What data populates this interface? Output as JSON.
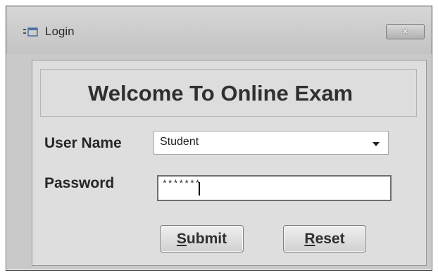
{
  "window": {
    "title": "Login",
    "close_label": "×"
  },
  "welcome": {
    "text": "Welcome To Online Exam"
  },
  "form": {
    "username_label": "User Name",
    "username_value": "Student",
    "password_label": "Password",
    "password_mask": "*******"
  },
  "buttons": {
    "submit_accel": "S",
    "submit_rest": "ubmit",
    "reset_accel": "R",
    "reset_rest": "eset"
  },
  "icons": {
    "app": "form-window-icon",
    "close": "close-icon",
    "dropdown": "chevron-down-icon"
  }
}
